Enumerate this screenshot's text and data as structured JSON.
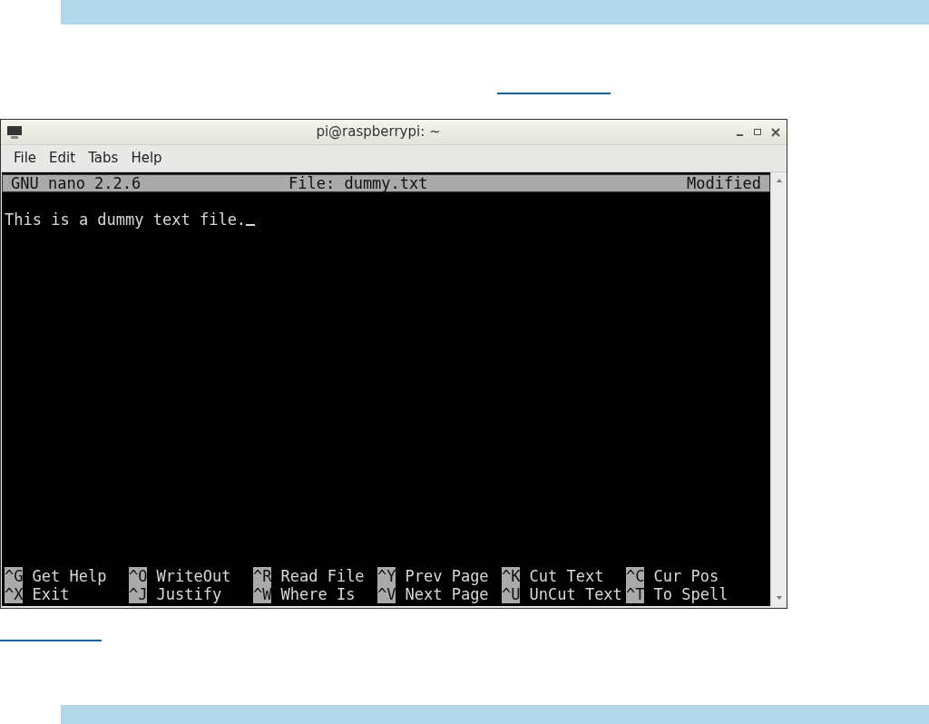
{
  "window": {
    "title": "pi@raspberrypi: ~"
  },
  "menu": [
    {
      "label": "File"
    },
    {
      "label": "Edit"
    },
    {
      "label": "Tabs"
    },
    {
      "label": "Help"
    }
  ],
  "nano": {
    "program": "GNU nano 2.2.6",
    "file": "File: dummy.txt",
    "status": "Modified",
    "lines": [
      "This is a dummy text file."
    ],
    "shortcuts": [
      [
        {
          "key": "^G",
          "label": "Get Help"
        },
        {
          "key": "^O",
          "label": "WriteOut"
        },
        {
          "key": "^R",
          "label": "Read File"
        },
        {
          "key": "^Y",
          "label": "Prev Page"
        },
        {
          "key": "^K",
          "label": "Cut Text"
        },
        {
          "key": "^C",
          "label": "Cur Pos"
        }
      ],
      [
        {
          "key": "^X",
          "label": "Exit"
        },
        {
          "key": "^J",
          "label": "Justify"
        },
        {
          "key": "^W",
          "label": "Where Is"
        },
        {
          "key": "^V",
          "label": "Next Page"
        },
        {
          "key": "^U",
          "label": "UnCut Text"
        },
        {
          "key": "^T",
          "label": "To Spell"
        }
      ]
    ]
  }
}
